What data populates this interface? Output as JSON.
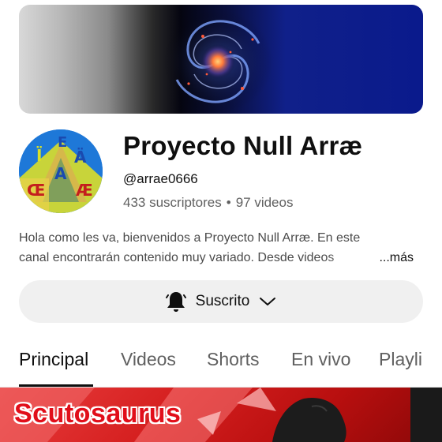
{
  "channel": {
    "name": "Proyecto Null Arræ",
    "handle": "@arrae0666",
    "subscribers": "433 suscriptores",
    "separator": "•",
    "videos": "97 videos",
    "avatar_letters": [
      "E",
      "Ï",
      "Ä",
      "A",
      "Œ",
      "Æ"
    ]
  },
  "description": {
    "line1": "Hola como les va, bienvenidos a Proyecto Null Arræ. En este",
    "line2": "canal encontrarán contenido muy variado. Desde videos",
    "more_label": "...más"
  },
  "subscribe": {
    "label": "Suscrito",
    "bell_icon": "bell-icon",
    "chevron_icon": "chevron-down-icon"
  },
  "tabs": [
    {
      "label": "Principal",
      "active": true
    },
    {
      "label": "Videos",
      "active": false
    },
    {
      "label": "Shorts",
      "active": false
    },
    {
      "label": "En vivo",
      "active": false
    },
    {
      "label": "Playli",
      "active": false
    }
  ],
  "featured_video": {
    "title": "Scutosaurus"
  },
  "colors": {
    "accent": "#0f0f0f",
    "secondary_text": "#606060",
    "subscribe_bg": "#f0f0f0",
    "thumbnail_red": "#d41e1e"
  }
}
